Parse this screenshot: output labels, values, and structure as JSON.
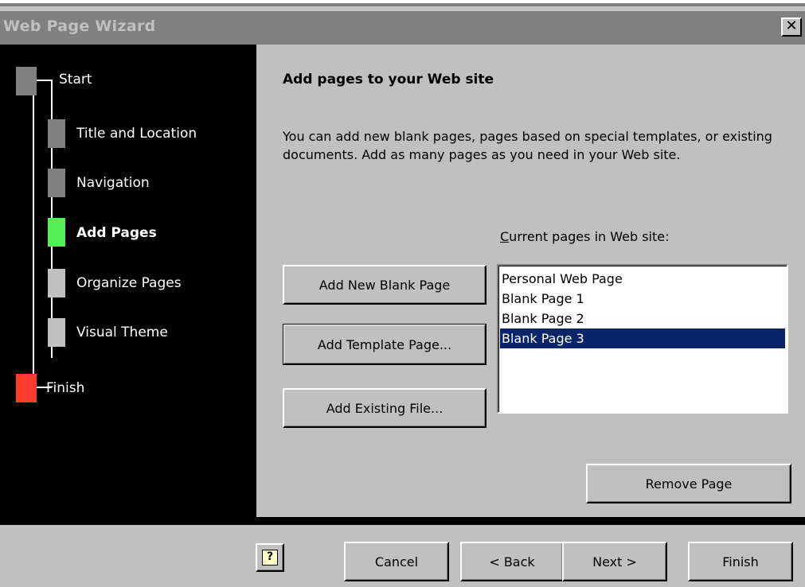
{
  "window": {
    "title": "Web Page Wizard",
    "close_label": "✕"
  },
  "sidebar": {
    "steps": [
      {
        "label": "Start",
        "color": "#808080",
        "bold": false
      },
      {
        "label": "Title and Location",
        "color": "#808080",
        "bold": false
      },
      {
        "label": "Navigation",
        "color": "#808080",
        "bold": false
      },
      {
        "label": "Add Pages",
        "color": "#55ee55",
        "bold": true
      },
      {
        "label": "Organize Pages",
        "color": "#c0c0c0",
        "bold": false
      },
      {
        "label": "Visual Theme",
        "color": "#c0c0c0",
        "bold": false
      },
      {
        "label": "Finish",
        "color": "#ff3b30",
        "bold": false
      }
    ]
  },
  "content": {
    "heading": "Add pages to your Web site",
    "description": "You can add new blank pages, pages based on special templates, or existing documents.  Add as many pages as you need in your Web site.",
    "list_label": "Current pages in Web site:",
    "add_blank_label": "Add New Blank Page",
    "add_template_label": "Add Template Page...",
    "add_existing_label": "Add Existing File...",
    "remove_label": "Remove Page",
    "pages": [
      "Personal Web Page",
      "Blank Page 1",
      "Blank Page 2",
      "Blank Page 3"
    ],
    "selected_page": "Blank Page 3"
  },
  "footer": {
    "help_label": "?",
    "cancel_label": "Cancel",
    "back_label": "< Back",
    "next_label": "Next >",
    "finish_label": "Finish"
  }
}
